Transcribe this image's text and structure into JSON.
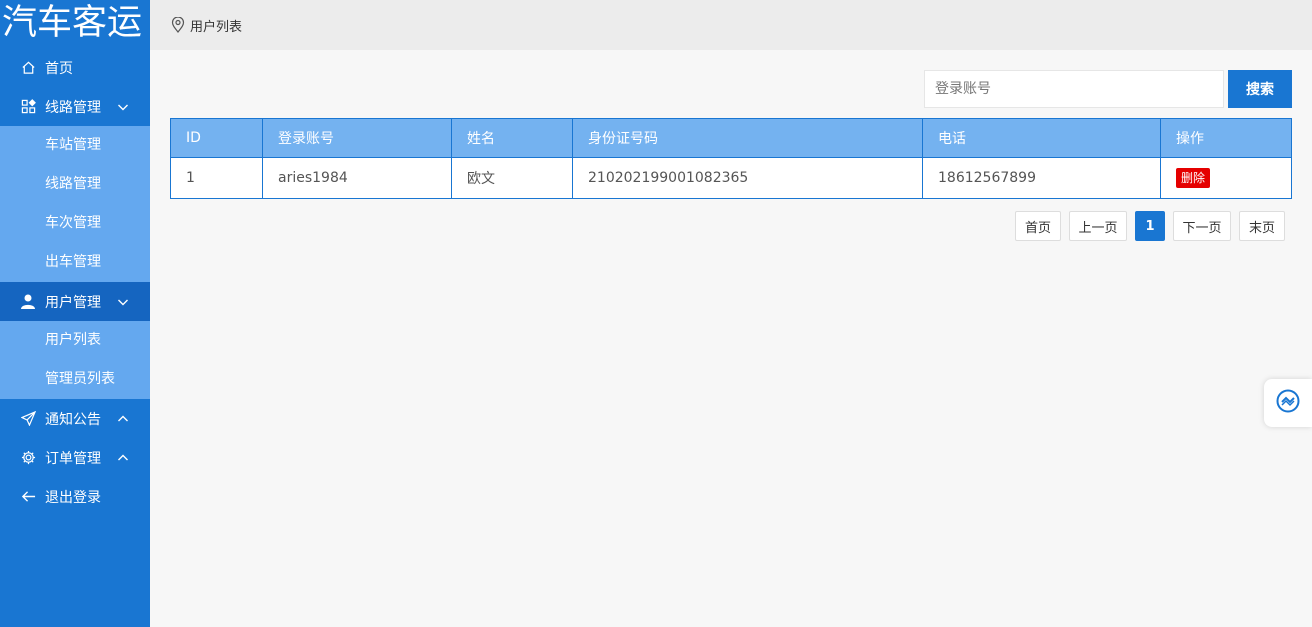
{
  "app": {
    "title": "汽车客运"
  },
  "sidebar": {
    "items": [
      {
        "label": "首页",
        "icon": "home-icon"
      },
      {
        "label": "线路管理",
        "icon": "grid-icon",
        "arrow": "chevron-down-icon",
        "children": [
          "车站管理",
          "线路管理",
          "车次管理",
          "出车管理"
        ]
      },
      {
        "label": "用户管理",
        "icon": "user-icon",
        "arrow": "chevron-down-icon",
        "children": [
          "用户列表",
          "管理员列表"
        ]
      },
      {
        "label": "通知公告",
        "icon": "send-icon",
        "arrow": "chevron-up-icon"
      },
      {
        "label": "订单管理",
        "icon": "gear-icon",
        "arrow": "chevron-up-icon"
      },
      {
        "label": "退出登录",
        "icon": "arrow-left-icon"
      }
    ]
  },
  "header": {
    "breadcrumb": "用户列表",
    "icon": "location-pin-icon"
  },
  "search": {
    "placeholder": "登录账号",
    "button_label": "搜索"
  },
  "table": {
    "headers": [
      "ID",
      "登录账号",
      "姓名",
      "身份证号码",
      "电话",
      "操作"
    ],
    "rows": [
      {
        "id": "1",
        "account": "aries1984",
        "name": "欧文",
        "id_number": "210202199001082365",
        "phone": "18612567899",
        "action": "删除"
      }
    ]
  },
  "pagination": {
    "first": "首页",
    "prev": "上一页",
    "current": "1",
    "next": "下一页",
    "last": "末页"
  },
  "colors": {
    "primary": "#1976d2",
    "submenu": "#64a8ef",
    "table_header": "#74b2f0",
    "danger": "#e50000"
  }
}
